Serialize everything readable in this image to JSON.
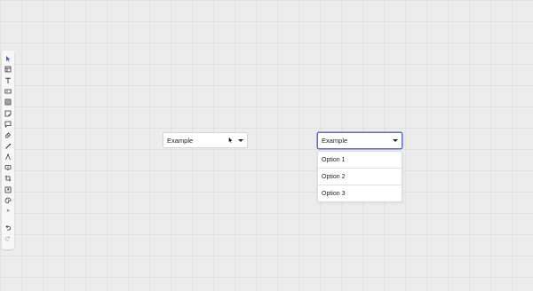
{
  "colors": {
    "canvas_background": "#ececec",
    "focus_border": "#5b6bd1",
    "selected_tool": "#4a62c9"
  },
  "toolbar": {
    "tools": [
      {
        "icon": "select-pointer-icon",
        "selected": true
      },
      {
        "icon": "frame-icon"
      },
      {
        "icon": "text-icon"
      },
      {
        "icon": "rectangle-icon"
      },
      {
        "icon": "table-icon"
      },
      {
        "icon": "sticky-note-icon"
      },
      {
        "icon": "comment-note-icon"
      },
      {
        "icon": "eraser-icon"
      },
      {
        "icon": "pen-icon"
      },
      {
        "icon": "compass-icon"
      },
      {
        "icon": "presentation-icon"
      },
      {
        "icon": "crop-icon"
      },
      {
        "icon": "embed-icon"
      },
      {
        "icon": "palette-icon"
      },
      {
        "icon": "more-tools-icon",
        "label": "»"
      }
    ],
    "history": [
      {
        "icon": "undo-icon"
      },
      {
        "icon": "redo-icon",
        "disabled": true
      }
    ]
  },
  "select_closed": {
    "value": "Example"
  },
  "select_open": {
    "value": "Example",
    "options": [
      "Option 1",
      "Option 2",
      "Option 3"
    ]
  }
}
